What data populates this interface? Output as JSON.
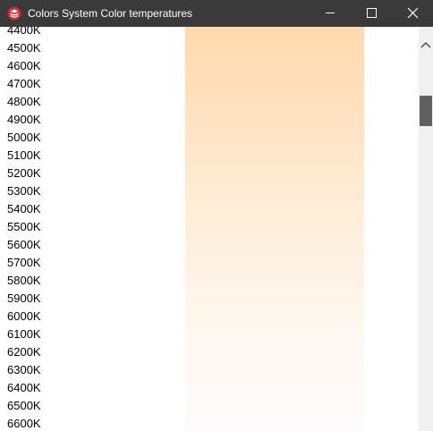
{
  "window": {
    "title": "Colors System Color temperatures",
    "icon": "sketchup-app-icon",
    "controls": [
      "minimize-icon",
      "maximize-icon",
      "close-icon"
    ]
  },
  "colors": {
    "titlebar": "#3a3a3a",
    "scrollbar_track": "#f0f0f0",
    "scrollbar_thumb": "#606060"
  },
  "temperatures": [
    {
      "label": "4400K",
      "color": "#ffd9ae"
    },
    {
      "label": "4500K",
      "color": "#ffdbb2"
    },
    {
      "label": "4600K",
      "color": "#ffddb6"
    },
    {
      "label": "4700K",
      "color": "#ffdfba"
    },
    {
      "label": "4800K",
      "color": "#ffe1bf"
    },
    {
      "label": "4900K",
      "color": "#ffe3c3"
    },
    {
      "label": "5000K",
      "color": "#ffe5c7"
    },
    {
      "label": "5100K",
      "color": "#ffe7cb"
    },
    {
      "label": "5200K",
      "color": "#ffe9cf"
    },
    {
      "label": "5300K",
      "color": "#ffebd3"
    },
    {
      "label": "5400K",
      "color": "#ffedd7"
    },
    {
      "label": "5500K",
      "color": "#ffeedb"
    },
    {
      "label": "5600K",
      "color": "#fff0df"
    },
    {
      "label": "5700K",
      "color": "#fff2e3"
    },
    {
      "label": "5800K",
      "color": "#fff3e7"
    },
    {
      "label": "5900K",
      "color": "#fff5ea"
    },
    {
      "label": "6000K",
      "color": "#fff6ee"
    },
    {
      "label": "6100K",
      "color": "#fff7f1"
    },
    {
      "label": "6200K",
      "color": "#fff8f4"
    },
    {
      "label": "6300K",
      "color": "#fff9f6"
    },
    {
      "label": "6400K",
      "color": "#fffaf8"
    },
    {
      "label": "6500K",
      "color": "#fffafa"
    },
    {
      "label": "6600K",
      "color": "#fffafb"
    }
  ]
}
